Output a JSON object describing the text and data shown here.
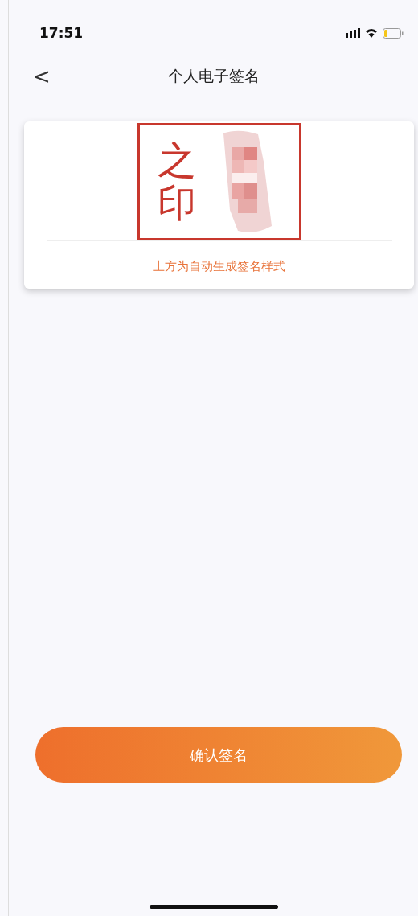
{
  "status_bar": {
    "time": "17:51"
  },
  "nav": {
    "back": "<",
    "title": "个人电子签名"
  },
  "signature_card": {
    "seal_chars": [
      "之",
      "印"
    ],
    "caption": "上方为自动生成签名样式"
  },
  "confirm_button": {
    "label": "确认签名"
  }
}
